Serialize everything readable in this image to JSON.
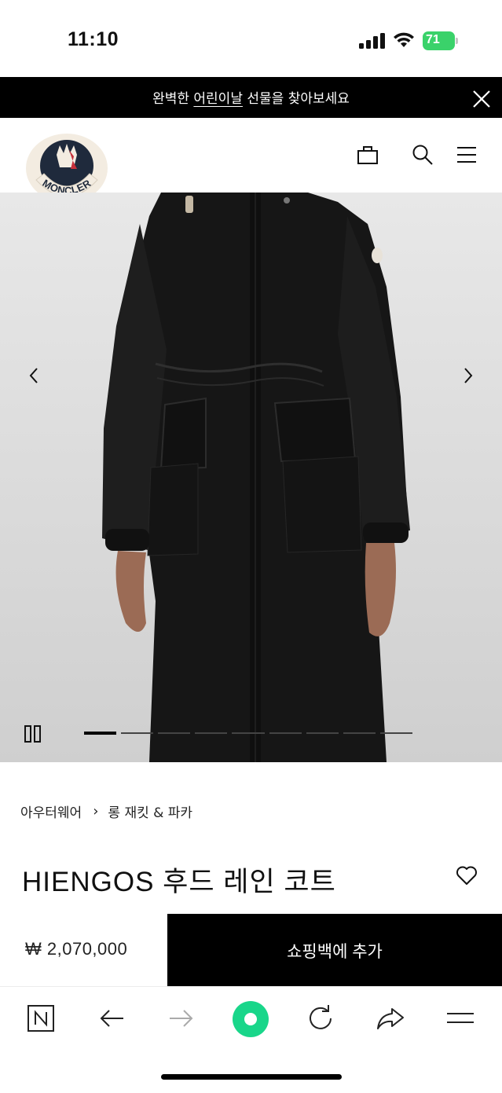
{
  "status_bar": {
    "time": "11:10",
    "battery": "71"
  },
  "promo": {
    "text_before": "완벽한 ",
    "link_text": "어린이날",
    "text_after": " 선물을 찾아보세요"
  },
  "header": {
    "logo_text": "MONCLER",
    "icons": [
      "bag-icon",
      "search-icon",
      "menu-icon"
    ]
  },
  "gallery": {
    "slide_count": 9,
    "active_index": 0
  },
  "breadcrumb": {
    "items": [
      "아우터웨어",
      "롱 재킷 & 파카"
    ]
  },
  "product": {
    "title": "HIENGOS 후드 레인 코트",
    "price": "₩ 2,070,000",
    "add_to_bag_label": "쇼핑백에 추가"
  },
  "browser_toolbar": {
    "icons": [
      "naver-home-icon",
      "back-arrow-icon",
      "forward-arrow-icon",
      "green-circle-icon",
      "refresh-icon",
      "share-icon",
      "menu-lines-icon"
    ]
  }
}
